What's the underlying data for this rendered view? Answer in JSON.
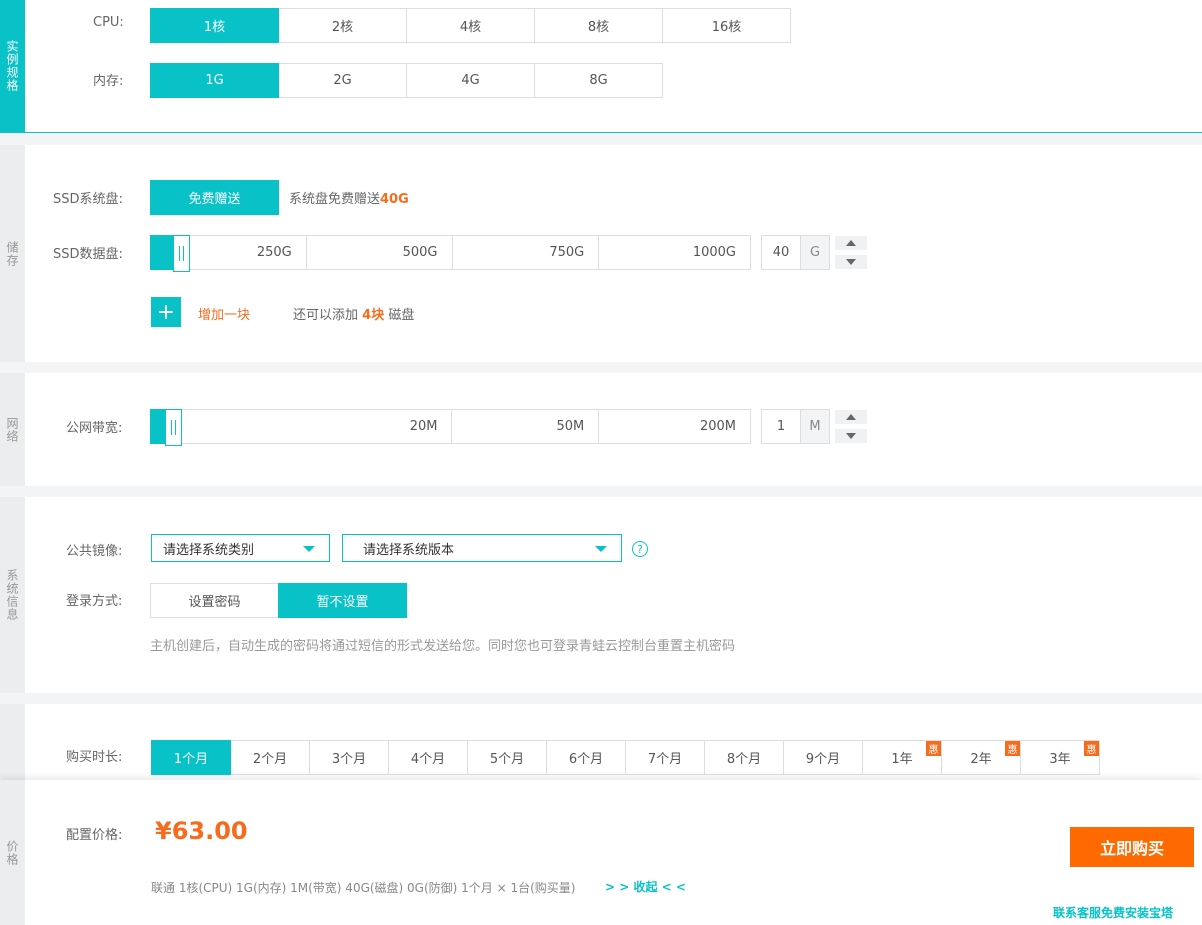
{
  "spec": {
    "side_label": "实例规格",
    "cpu_label": "CPU:",
    "cpu_options": [
      "1核",
      "2核",
      "4核",
      "8核",
      "16核"
    ],
    "mem_label": "内存:",
    "mem_options": [
      "1G",
      "2G",
      "4G",
      "8G"
    ]
  },
  "storage": {
    "side_label": "储存",
    "sys_label": "SSD系统盘:",
    "sys_button": "免费赠送",
    "sys_note_prefix": "系统盘免费赠送",
    "sys_note_value": "40G",
    "data_label": "SSD数据盘:",
    "data_marks": [
      "250G",
      "500G",
      "750G",
      "1000G"
    ],
    "data_value": "40",
    "data_unit": "G",
    "add_button": "+",
    "add_label": "增加一块",
    "remaining_prefix": "还可以添加",
    "remaining_value": "4块",
    "remaining_suffix": "磁盘"
  },
  "network": {
    "side_label": "网络",
    "bw_label": "公网带宽:",
    "bw_marks": [
      "20M",
      "50M",
      "200M"
    ],
    "bw_value": "1",
    "bw_unit": "M"
  },
  "system": {
    "side_label": "系统信息",
    "image_label": "公共镜像:",
    "os_type_placeholder": "请选择系统类别",
    "os_version_placeholder": "请选择系统版本",
    "help": "?",
    "login_label": "登录方式:",
    "login_options": [
      "设置密码",
      "暂不设置"
    ],
    "note": "主机创建后，自动生成的密码将通过短信的形式发送给您。同时您也可登录青蛙云控制台重置主机密码"
  },
  "duration": {
    "label": "购买时长:",
    "options": [
      "1个月",
      "2个月",
      "3个月",
      "4个月",
      "5个月",
      "6个月",
      "7个月",
      "8个月",
      "9个月",
      "1年",
      "2年",
      "3年"
    ],
    "badge": "惠"
  },
  "price": {
    "side_label": "价格",
    "label": "配置价格:",
    "value": "¥63.00",
    "summary": "联通  1核(CPU)  1G(内存)  1M(带宽)  40G(磁盘)  0G(防御)  1个月 × 1台(购买量)",
    "collapse": "> > 收起 < <",
    "buy_button": "立即购买",
    "contact": "联系客服免费安装宝塔"
  },
  "colors": {
    "accent": "#08c2c8",
    "orange": "#f76b1c",
    "buy": "#ff6a00"
  }
}
